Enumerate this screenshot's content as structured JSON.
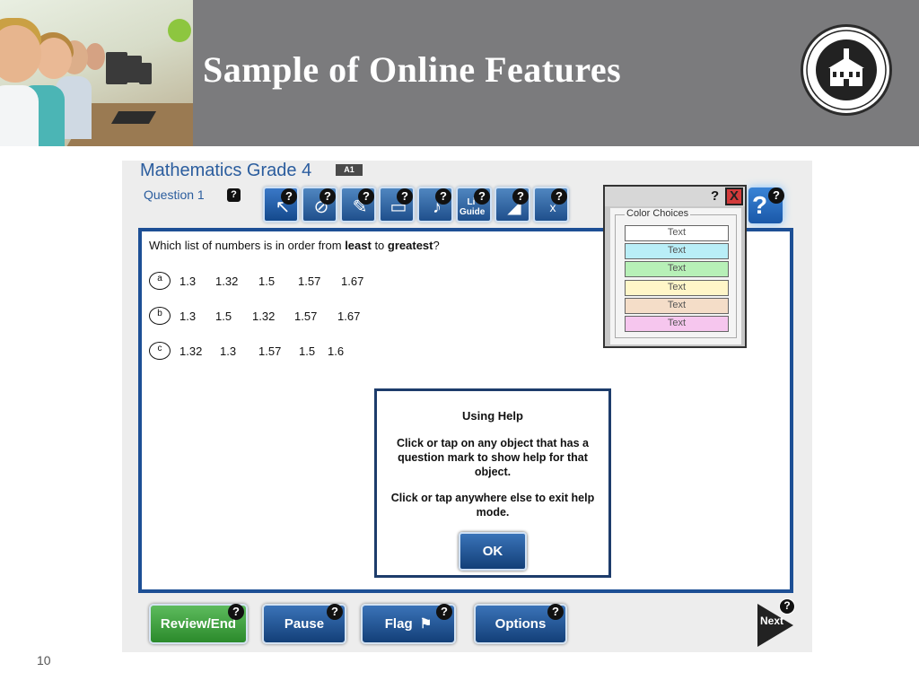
{
  "slide": {
    "title": "Sample of Online Features",
    "number": "10",
    "accent_color": "#8dc63f",
    "header_color": "#7b7b7d"
  },
  "app": {
    "title": "Mathematics Grade 4",
    "badge": "A1",
    "question_label": "Question 1",
    "help_mark": "?",
    "toolbar": [
      {
        "icon": "pointer-icon",
        "glyph": "↖"
      },
      {
        "icon": "strikeout-icon",
        "glyph": "⊘"
      },
      {
        "icon": "highlighter-icon",
        "glyph": "✎"
      },
      {
        "icon": "notepad-icon",
        "glyph": "▭"
      },
      {
        "icon": "microphone-icon",
        "glyph": "♪"
      },
      {
        "icon": "line-guide-icon",
        "text": "Li Guide"
      },
      {
        "icon": "ruler-icon",
        "glyph": "◢"
      },
      {
        "icon": "dictionary-icon",
        "glyph": "x"
      }
    ],
    "prompt_before": "Which list of numbers is in order from ",
    "prompt_least": "least",
    "prompt_middle": " to ",
    "prompt_greatest": "greatest",
    "prompt_after": "?",
    "options": [
      {
        "letter": "a",
        "values": [
          "1.3",
          "1.32",
          "1.5",
          "1.57",
          "1.67"
        ]
      },
      {
        "letter": "b",
        "values": [
          "1.3",
          "1.5",
          "1.32",
          "1.57",
          "1.67"
        ]
      },
      {
        "letter": "c",
        "values": [
          "1.32",
          "1.3",
          "1.57",
          "1.5",
          "1.6"
        ]
      }
    ],
    "help_dialog": {
      "heading": "Using Help",
      "text1": "Click or tap on any object that has a question mark to show help for that object.",
      "text2": "Click or tap anywhere else to exit help mode.",
      "ok_label": "OK"
    },
    "color_choices": {
      "legend": "Color Choices",
      "close_label": "X",
      "items": [
        {
          "label": "Text",
          "color": "#ffffff"
        },
        {
          "label": "Text",
          "color": "#b9eef7"
        },
        {
          "label": "Text",
          "color": "#b7f0b7"
        },
        {
          "label": "Text",
          "color": "#fff6c8"
        },
        {
          "label": "Text",
          "color": "#f4ddc8"
        },
        {
          "label": "Text",
          "color": "#f6c6ee"
        }
      ]
    },
    "bottom_buttons": {
      "review": "Review/End Test",
      "pause": "Pause",
      "flag": "Flag",
      "flag_glyph": "⚑",
      "options": "Options",
      "next": "Next"
    }
  }
}
